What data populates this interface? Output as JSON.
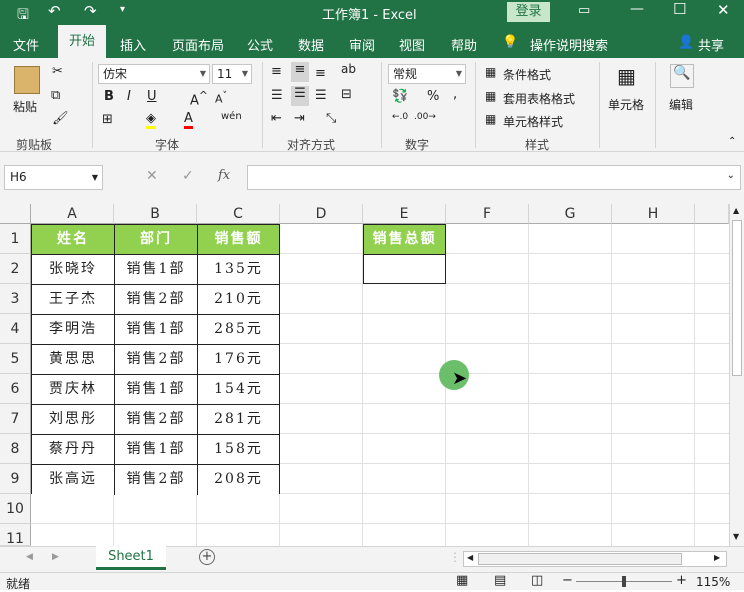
{
  "titlebar": {
    "title": "工作簿1 - Excel",
    "login": "登录"
  },
  "tabs": [
    "文件",
    "开始",
    "插入",
    "页面布局",
    "公式",
    "数据",
    "审阅",
    "视图",
    "帮助"
  ],
  "tell_me": "操作说明搜索",
  "share": "共享",
  "ribbon": {
    "paste": "粘贴",
    "clipboard": "剪贴板",
    "font_name": "仿宋",
    "font_size": "11",
    "font_group": "字体",
    "align_group": "对齐方式",
    "number_format": "常规",
    "number_group": "数字",
    "cond_format": "条件格式",
    "table_format": "套用表格格式",
    "cell_style": "单元格样式",
    "style_group": "样式",
    "cells": "单元格",
    "editing": "编辑"
  },
  "namebox": "H6",
  "fx": "fx",
  "columns": [
    "A",
    "B",
    "C",
    "D",
    "E",
    "F",
    "G",
    "H"
  ],
  "rows": [
    "1",
    "2",
    "3",
    "4",
    "5",
    "6",
    "7",
    "8",
    "9",
    "10",
    "11"
  ],
  "table": {
    "headers": [
      "姓名",
      "部门",
      "销售额"
    ],
    "data": [
      [
        "张晓玲",
        "销售1部",
        "135元"
      ],
      [
        "王子杰",
        "销售2部",
        "210元"
      ],
      [
        "李明浩",
        "销售1部",
        "285元"
      ],
      [
        "黄思思",
        "销售2部",
        "176元"
      ],
      [
        "贾庆林",
        "销售1部",
        "154元"
      ],
      [
        "刘思彤",
        "销售2部",
        "281元"
      ],
      [
        "蔡丹丹",
        "销售1部",
        "158元"
      ],
      [
        "张高远",
        "销售2部",
        "208元"
      ]
    ]
  },
  "summary": {
    "header": "销售总额",
    "value": ""
  },
  "sheet_tab": "Sheet1",
  "status": {
    "ready": "就绪",
    "zoom": "115%"
  },
  "colors": {
    "excel_green": "#217346",
    "header_fill": "#92d050"
  }
}
